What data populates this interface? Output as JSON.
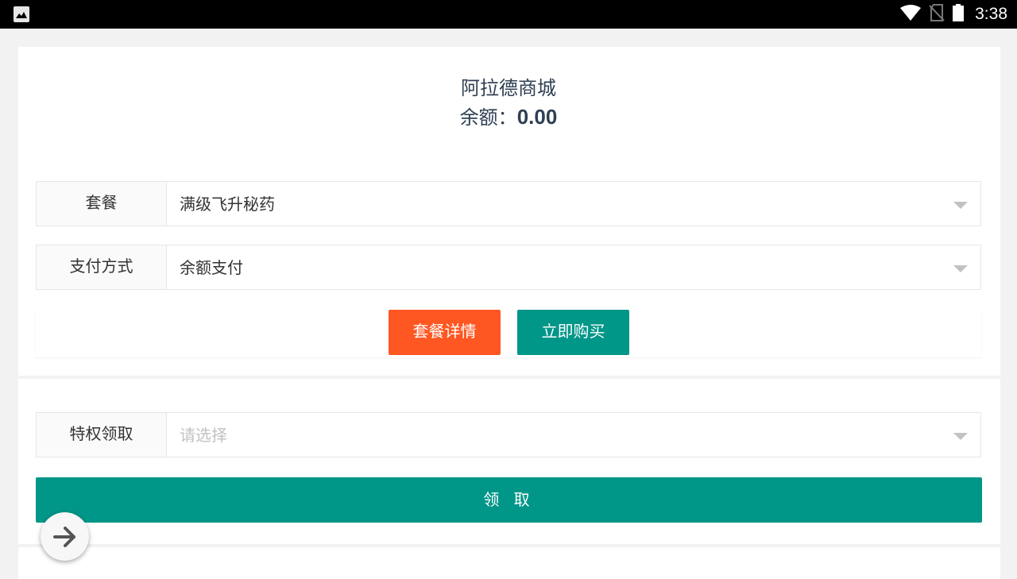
{
  "status_bar": {
    "time": "3:38",
    "icons": [
      "image-notification-icon",
      "wifi-icon",
      "no-sim-icon",
      "battery-icon"
    ]
  },
  "header": {
    "shop_name": "阿拉德商城",
    "balance_label": "余额：",
    "balance_value": "0.00"
  },
  "purchase_form": {
    "package": {
      "label": "套餐",
      "value": "满级飞升秘药"
    },
    "payment": {
      "label": "支付方式",
      "value": "余额支付"
    },
    "detail_button": "套餐详情",
    "buy_button": "立即购买"
  },
  "privilege_form": {
    "privilege": {
      "label": "特权领取",
      "placeholder": "请选择"
    },
    "claim_button": "领 取"
  },
  "colors": {
    "primary": "#009688",
    "accent": "#ff5722",
    "text": "#2f4054"
  },
  "fab": {
    "icon": "arrow-right-icon"
  }
}
